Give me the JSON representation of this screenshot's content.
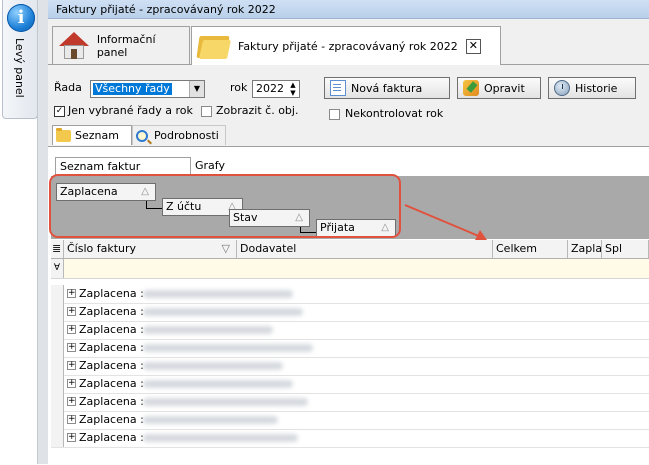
{
  "left_panel": {
    "label": "Levý panel",
    "icon": "info-icon"
  },
  "window": {
    "title": "Faktury přijaté - zpracovávaný rok 2022"
  },
  "tabs": [
    {
      "label": "Informační panel",
      "icon": "house-icon"
    },
    {
      "label": "Faktury přijaté - zpracovávaný rok 2022",
      "icon": "folder-icon",
      "close": "✕"
    }
  ],
  "toolbar": {
    "rada_label": "Řada",
    "rada_value": "Všechny řady",
    "rok_label": "rok",
    "rok_value": "2022",
    "new_invoice": "Nová faktura",
    "edit": "Opravit",
    "history": "Historie",
    "only_selected": "Jen vybrané řady a rok",
    "only_selected_checked": true,
    "show_obj": "Zobrazit č. obj.",
    "show_obj_checked": false,
    "no_check": "Nekontrolovat rok",
    "no_check_checked": false
  },
  "view_tabs": [
    "Seznam",
    "Podrobnosti"
  ],
  "inner_tabs": [
    "Seznam faktur přijatých",
    "Grafy"
  ],
  "group_by": [
    {
      "label": "Zaplacena",
      "sort": "△"
    },
    {
      "label": "Z účtu",
      "sort": "△"
    },
    {
      "label": "Stav",
      "sort": "△"
    },
    {
      "label": "Přijata",
      "sort": "△"
    }
  ],
  "grid": {
    "columns": [
      "Číslo faktury",
      "Dodavatel",
      "Celkem",
      "Zapla",
      "Spl"
    ],
    "sort_indicator": "▽",
    "rows": [
      "Zaplacena :",
      "Zaplacena :",
      "Zaplacena :",
      "Zaplacena :",
      "Zaplacena :",
      "Zaplacena :",
      "Zaplacena :",
      "Zaplacena :",
      "Zaplacena :"
    ]
  },
  "colors": {
    "annotation": "#e0523e",
    "selection": "#0078d7",
    "group_area": "#a9a9a9"
  }
}
